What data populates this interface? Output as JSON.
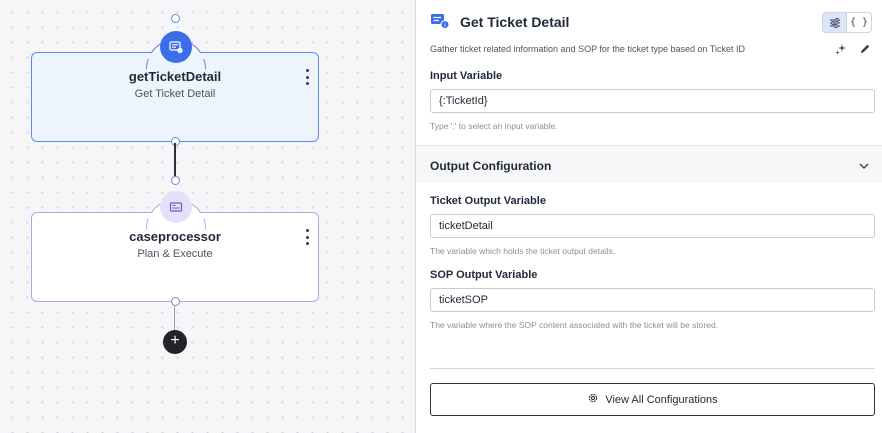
{
  "canvas": {
    "nodes": [
      {
        "title": "getTicketDetail",
        "subtitle": "Get Ticket Detail",
        "icon": "ticket-icon",
        "selected": true
      },
      {
        "title": "caseprocessor",
        "subtitle": "Plan & Execute",
        "icon": "card-icon",
        "selected": false
      }
    ],
    "add_label": "+"
  },
  "panel": {
    "icon": "ticket-detail-icon",
    "title": "Get Ticket Detail",
    "view_toggles": [
      "sliders-icon",
      "{ }"
    ],
    "description": "Gather ticket related information and SOP for the ticket type based on Ticket ID",
    "input_variable": {
      "label": "Input Variable",
      "value": "{:TicketId}",
      "hint": "Type ':' to select an input variable."
    },
    "output_section": {
      "title": "Output Configuration",
      "expanded": true,
      "fields": [
        {
          "label": "Ticket Output Variable",
          "value": "ticketDetail",
          "hint": "The variable which holds the ticket output details."
        },
        {
          "label": "SOP Output Variable",
          "value": "ticketSOP",
          "hint": "The variable where the SOP content associated with the ticket will be stored."
        }
      ]
    },
    "view_all_label": "View All Configurations"
  },
  "colors": {
    "accent": "#3b6ee8",
    "selected_border": "#5b8def",
    "secondary_border": "#b6a4e6",
    "add_button": "#23232b"
  }
}
